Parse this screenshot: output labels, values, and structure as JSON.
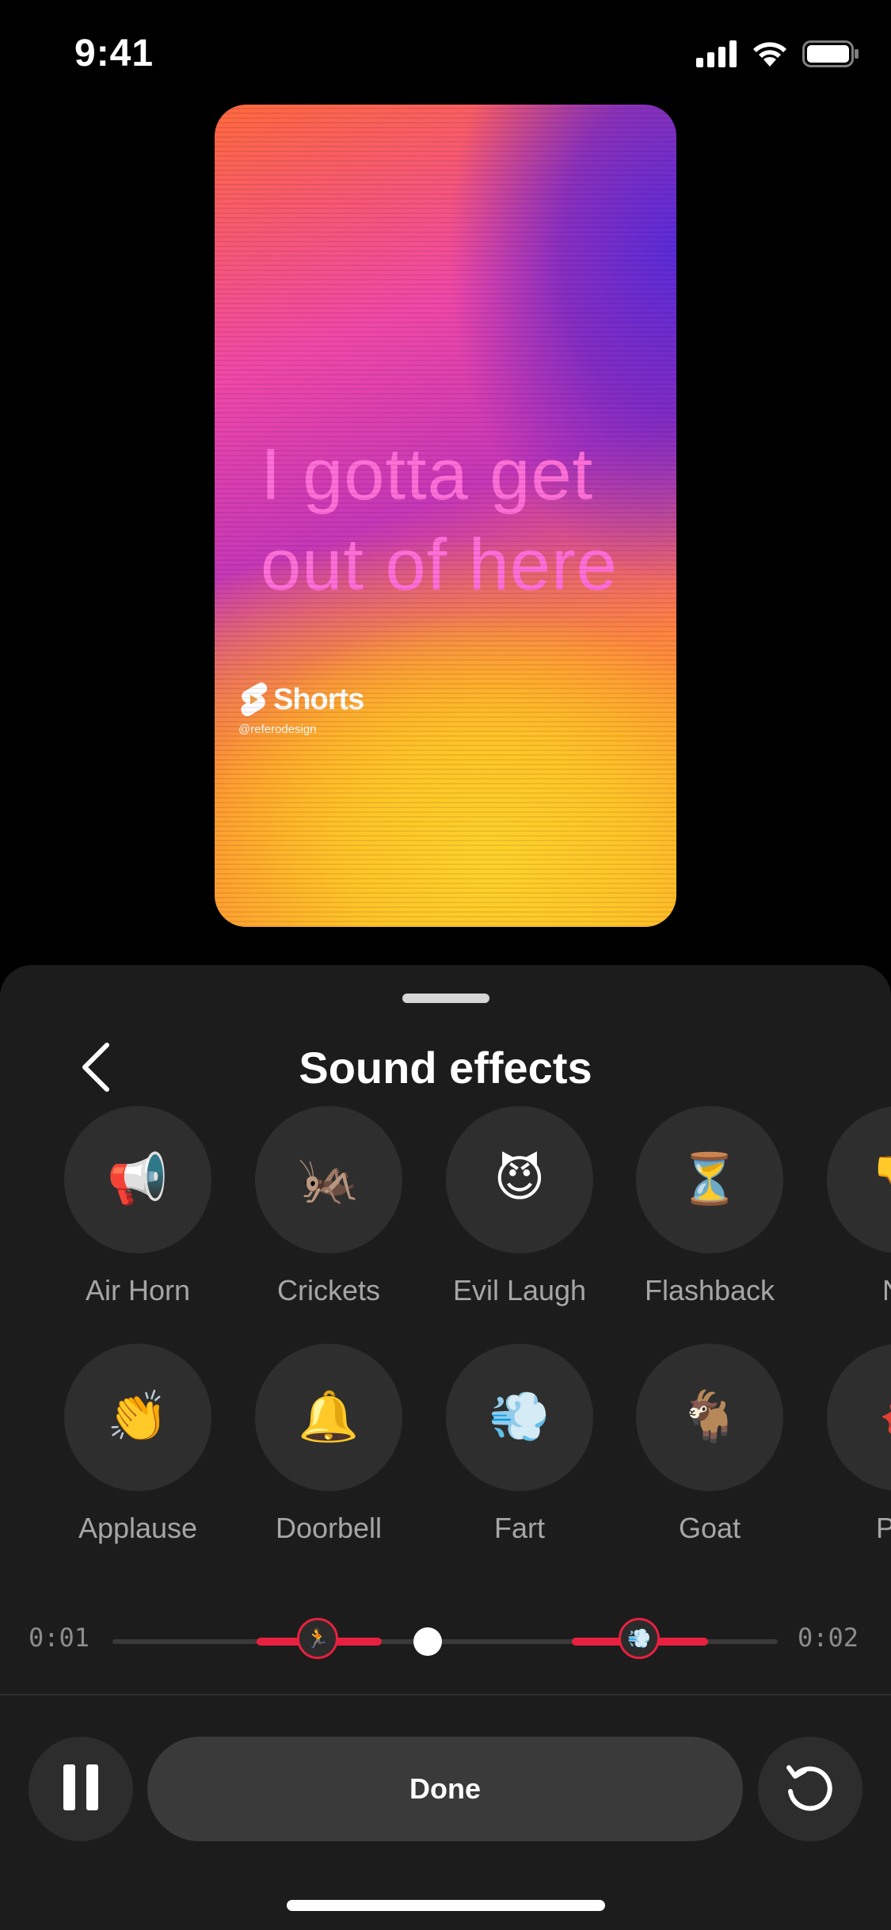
{
  "status_bar": {
    "time": "9:41"
  },
  "preview": {
    "caption_lines": [
      "I gotta get",
      "out of here"
    ],
    "brand": "Shorts",
    "handle": "@referodesign"
  },
  "sheet": {
    "title": "Sound effects",
    "effects_row1": [
      {
        "label": "Air Horn",
        "icon": "📢",
        "icon_name": "air-horn-icon"
      },
      {
        "label": "Crickets",
        "icon": "🦗",
        "icon_name": "cricket-icon"
      },
      {
        "label": "Evil Laugh",
        "icon": "😈",
        "icon_name": "devil-icon"
      },
      {
        "label": "Flashback",
        "icon": "⏳",
        "icon_name": "hourglass-icon"
      },
      {
        "label": "No",
        "icon": "👎",
        "icon_name": "thumbs-icon"
      }
    ],
    "effects_row2": [
      {
        "label": "Applause",
        "icon": "👏",
        "icon_name": "clapping-icon"
      },
      {
        "label": "Doorbell",
        "icon": "🔔",
        "icon_name": "bell-icon"
      },
      {
        "label": "Fart",
        "icon": "💨",
        "icon_name": "dash-icon"
      },
      {
        "label": "Goat",
        "icon": "🐐",
        "icon_name": "goat-icon"
      },
      {
        "label": "Plot",
        "icon": "🦸",
        "icon_name": "superhero-icon"
      }
    ]
  },
  "timeline": {
    "start_time": "0:01",
    "end_time": "0:02",
    "markers": [
      {
        "icon": "🏃",
        "icon_name": "running-icon"
      },
      {
        "icon": "💨",
        "icon_name": "dash-icon"
      }
    ]
  },
  "controls": {
    "done_label": "Done"
  },
  "colors": {
    "accent": "#e8203f",
    "sheet_bg": "#1c1c1c",
    "circle_bg": "#2e2e2e"
  }
}
